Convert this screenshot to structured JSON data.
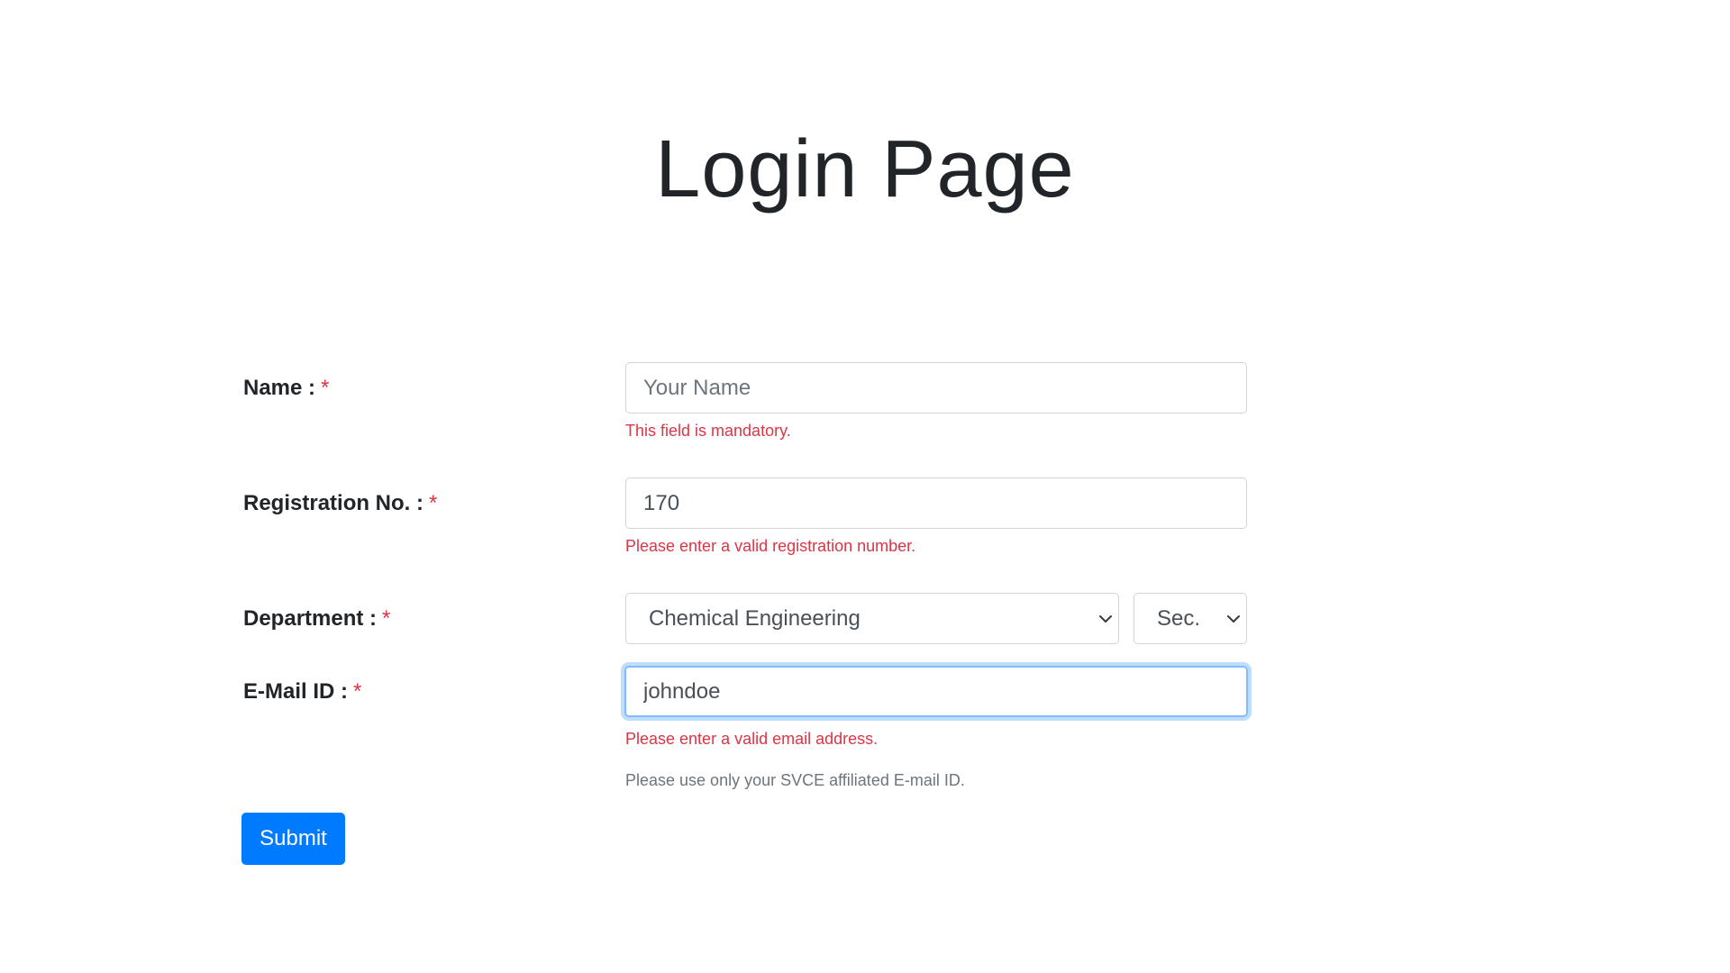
{
  "page": {
    "title": "Login Page"
  },
  "form": {
    "required_marker": "*",
    "name": {
      "label": "Name :",
      "value": "",
      "placeholder": "Your Name",
      "error": "This field is mandatory."
    },
    "registration": {
      "label": "Registration No. :",
      "value": "170",
      "error": "Please enter a valid registration number."
    },
    "department": {
      "label": "Department :",
      "selected": "Chemical Engineering",
      "section_selected": "Sec."
    },
    "email": {
      "label": "E-Mail ID :",
      "value": "johndoe",
      "error": "Please enter a valid email address.",
      "hint": "Please use only your SVCE affiliated E-mail ID."
    },
    "submit_label": "Submit"
  },
  "colors": {
    "primary": "#007bff",
    "error": "#dc3545",
    "muted": "#6c757d",
    "focus_ring": "#80bdff"
  },
  "icons": {
    "select_arrow": "chevron-down-icon"
  }
}
